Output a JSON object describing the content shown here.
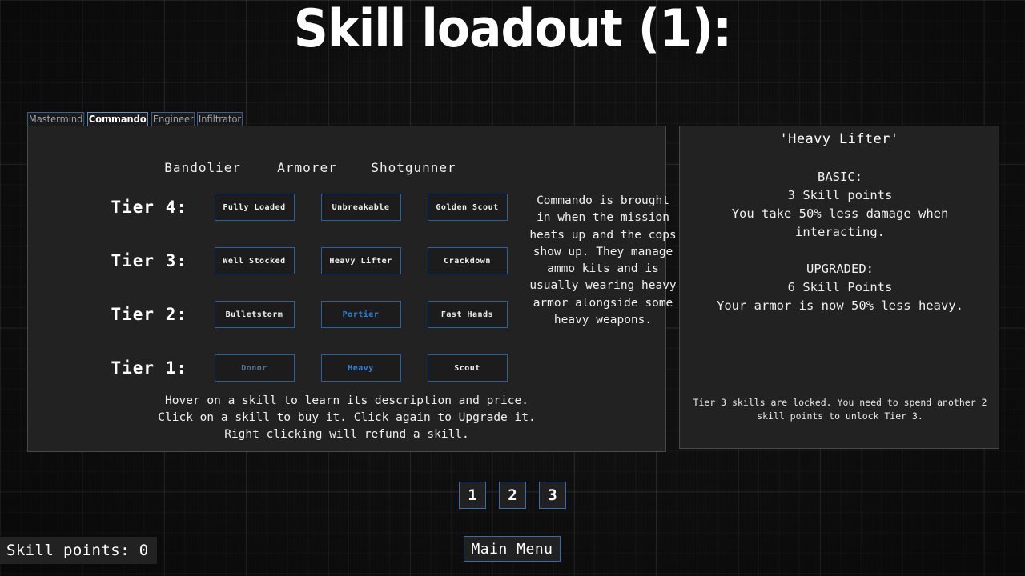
{
  "title": "Skill loadout (1):",
  "colors": {
    "background": "#101010",
    "panel": "#222222",
    "panel_border": "#4a4a4a",
    "skill_border": "#2f5f9b",
    "accent_blue": "#2f7fe0",
    "locked_blue": "#5b7191",
    "text": "#f0f0f0"
  },
  "class_tabs": [
    {
      "label": "Mastermind",
      "selected": false
    },
    {
      "label": "Commando",
      "selected": true
    },
    {
      "label": "Engineer",
      "selected": false
    },
    {
      "label": "Infiltrator",
      "selected": false
    }
  ],
  "skill_panel": {
    "columns": [
      "Bandolier",
      "Armorer",
      "Shotgunner"
    ],
    "tiers": [
      {
        "label": "Tier 4:",
        "skills": [
          {
            "name": "Fully Loaded",
            "state": "available"
          },
          {
            "name": "Unbreakable",
            "state": "available"
          },
          {
            "name": "Golden Scout",
            "state": "available"
          }
        ]
      },
      {
        "label": "Tier 3:",
        "skills": [
          {
            "name": "Well Stocked",
            "state": "available"
          },
          {
            "name": "Heavy Lifter",
            "state": "available"
          },
          {
            "name": "Crackdown",
            "state": "available"
          }
        ]
      },
      {
        "label": "Tier 2:",
        "skills": [
          {
            "name": "Bulletstorm",
            "state": "available"
          },
          {
            "name": "Portier",
            "state": "owned"
          },
          {
            "name": "Fast Hands",
            "state": "available"
          }
        ]
      },
      {
        "label": "Tier 1:",
        "skills": [
          {
            "name": "Donor",
            "state": "locked"
          },
          {
            "name": "Heavy",
            "state": "owned"
          },
          {
            "name": "Scout",
            "state": "available"
          }
        ]
      }
    ],
    "class_blurb": "Commando is brought in when the mission heats up and the cops show up. They manage ammo kits and is usually wearing heavy armor alongside some heavy weapons.",
    "instructions": [
      "Hover on a skill to learn its description and price.",
      "Click on a skill to buy it. Click again to Upgrade it.",
      "Right clicking will refund a skill."
    ]
  },
  "info_panel": {
    "title": "'Heavy Lifter'",
    "lines": [
      "BASIC:",
      "3 Skill points",
      "You take 50% less damage when interacting.",
      "",
      "UPGRADED:",
      "6 Skill Points",
      "Your armor is now 50% less heavy."
    ],
    "footer": "Tier 3 skills are locked. You need to spend another 2 skill points to unlock Tier 3."
  },
  "loadout_slots": [
    "1",
    "2",
    "3"
  ],
  "main_menu_label": "Main Menu",
  "skill_points_label": "Skill points: 0"
}
